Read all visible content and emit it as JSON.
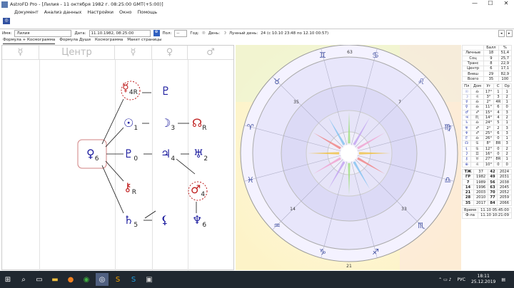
{
  "window": {
    "title": "AstroFD Pro - [Лилия - 11 октября 1982 г. 08:25:00 GMT(+5:00)]",
    "controls": [
      "—",
      "☐",
      "✕"
    ]
  },
  "menu": [
    "Документ",
    "Анализ данных",
    "Настройки",
    "Окно",
    "Помощь"
  ],
  "inputs": {
    "name_label": "Имя:",
    "name_value": "Лилия",
    "date_label": "Дата:",
    "date_value": "11.10.1982, 08:25:00",
    "sex_label": "Пол:",
    "sex_value": "--",
    "year_label": "Год:",
    "year_icon": "☉",
    "day_label": "День:",
    "day_icon": "☽",
    "lunar_label": "Лунный день:",
    "lunar_value": "24 (с 10.10 23:48 по 12.10 00:57)"
  },
  "tabs": [
    "Формула + Космограмма",
    "Формула Души",
    "Космограмма",
    "Макет страницы"
  ],
  "formula": {
    "headers": [
      "☿",
      "Центр",
      "☿",
      "♀",
      "♂"
    ],
    "nodes": [
      {
        "glyph": "☿",
        "num": "4",
        "extra": "R",
        "color": "#c02020"
      },
      {
        "glyph": "♇",
        "num": "",
        "extra": "",
        "color": "#2020a0"
      },
      {
        "glyph": "☉",
        "num": "1",
        "extra": "",
        "color": "#2020a0"
      },
      {
        "glyph": "☽",
        "num": "3",
        "extra": "",
        "color": "#2020a0"
      },
      {
        "glyph": "☊",
        "num": "",
        "extra": "R",
        "color": "#c02020"
      },
      {
        "glyph": "♀",
        "num": "6",
        "extra": "",
        "color": "#2020a0"
      },
      {
        "glyph": "♇",
        "num": "0",
        "extra": "",
        "color": "#2020a0"
      },
      {
        "glyph": "♃",
        "num": "4",
        "extra": "",
        "color": "#2020a0"
      },
      {
        "glyph": "♅",
        "num": "2",
        "extra": "",
        "color": "#2020a0"
      },
      {
        "glyph": "⚷",
        "num": "",
        "extra": "R",
        "color": "#c02020"
      },
      {
        "glyph": "♂",
        "num": "4",
        "extra": "",
        "color": "#c02020"
      },
      {
        "glyph": "♄",
        "num": "5",
        "extra": "",
        "color": "#2020a0"
      },
      {
        "glyph": "⚸",
        "num": "",
        "extra": "",
        "color": "#2020a0"
      },
      {
        "glyph": "♆",
        "num": "6",
        "extra": "",
        "color": "#2020a0"
      }
    ]
  },
  "wheel": {
    "degree_labels": [
      "63",
      "21",
      "33",
      "14",
      "7",
      "35"
    ],
    "signs": [
      "♈",
      "♉",
      "♊",
      "♋",
      "♌",
      "♍",
      "♎",
      "♏",
      "♐",
      "♑",
      "♒",
      "♓"
    ]
  },
  "scores": {
    "headers": [
      "",
      "Балл",
      "%"
    ],
    "rows": [
      [
        "Личные",
        "18",
        "51,4"
      ],
      [
        "Соц",
        "9",
        "25,7"
      ],
      [
        "Транс",
        "8",
        "22,9"
      ],
      [
        "Центр",
        "6",
        "17,1"
      ],
      [
        "Внеш",
        "29",
        "82,9"
      ],
      [
        "Всего",
        "35",
        "100"
      ]
    ]
  },
  "planets": {
    "headers": [
      "Пл",
      "Дом",
      "Уг",
      "С",
      "Ор"
    ],
    "rows": [
      [
        "☉",
        "♎",
        "17°",
        "1",
        "1"
      ],
      [
        "☽",
        "♌",
        "3°",
        "3",
        "2"
      ],
      [
        "☿",
        "♎",
        "2°",
        "4R",
        "1"
      ],
      [
        "♀",
        "♎",
        "11°",
        "6",
        "0"
      ],
      [
        "♂",
        "♐",
        "15°",
        "4",
        "3"
      ],
      [
        "♃",
        "♏",
        "14°",
        "4",
        "2"
      ],
      [
        "♄",
        "♎",
        "24°",
        "5",
        "1"
      ],
      [
        "♅",
        "♐",
        "2°",
        "2",
        "3"
      ],
      [
        "♆",
        "♐",
        "25°",
        "6",
        "3"
      ],
      [
        "♇",
        "♎",
        "26°",
        "0",
        "1"
      ],
      [
        "☊",
        "♋",
        "8°",
        "8R",
        "3"
      ],
      [
        "⚸",
        "♋",
        "12°",
        "0",
        "2"
      ],
      [
        "⚳",
        "♊",
        "16°",
        "0",
        "2"
      ],
      [
        "⚷",
        "♉",
        "27°",
        "8R",
        "1"
      ],
      [
        "⊕",
        "♌",
        "10°",
        "0",
        "0"
      ]
    ]
  },
  "years": {
    "rows": [
      [
        "ТЖ",
        "37",
        "42",
        "2024"
      ],
      [
        "ГР",
        "1982",
        "49",
        "2031"
      ],
      [
        "7",
        "1989",
        "56",
        "2038"
      ],
      [
        "14",
        "1996",
        "63",
        "2045"
      ],
      [
        "21",
        "2003",
        "70",
        "2052"
      ],
      [
        "28",
        "2010",
        "77",
        "2059"
      ],
      [
        "35",
        "2017",
        "84",
        "2066"
      ]
    ]
  },
  "times": [
    [
      "Время",
      "11.10 05:45:00"
    ],
    [
      "Ф-ла",
      "11.10 10:21:09"
    ]
  ],
  "taskbar": {
    "lang": "РУС",
    "time": "18:11",
    "date": "25.12.2019"
  }
}
